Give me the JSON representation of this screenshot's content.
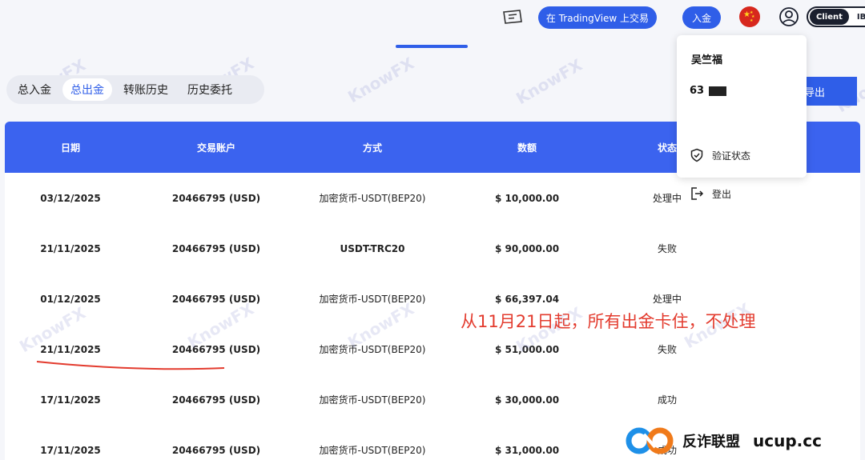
{
  "header": {
    "trade_button": "在 TradingView 上交易",
    "deposit_button": "入金",
    "role_toggle": {
      "client": "Client",
      "ib": "IB"
    },
    "ticket_icon": "ticket-icon",
    "flag_icon": "china-flag-icon",
    "user_icon": "user-icon"
  },
  "tabs": [
    {
      "label": "总入金",
      "active": false
    },
    {
      "label": "总出金",
      "active": true
    },
    {
      "label": "转账历史",
      "active": false
    },
    {
      "label": "历史委托",
      "active": false
    }
  ],
  "export_button": "导出",
  "table": {
    "columns": [
      "日期",
      "交易账户",
      "方式",
      "数额",
      "状态"
    ],
    "rows": [
      {
        "date": "03/12/2025",
        "account": "20466795 (USD)",
        "method": "加密货币-USDT(BEP20)",
        "amount": "$ 10,000.00",
        "status": "处理中"
      },
      {
        "date": "21/11/2025",
        "account": "20466795 (USD)",
        "method": "USDT-TRC20",
        "amount": "$ 90,000.00",
        "status": "失败"
      },
      {
        "date": "01/12/2025",
        "account": "20466795 (USD)",
        "method": "加密货币-USDT(BEP20)",
        "amount": "$ 66,397.04",
        "status": "处理中"
      },
      {
        "date": "21/11/2025",
        "account": "20466795 (USD)",
        "method": "加密货币-USDT(BEP20)",
        "amount": "$ 51,000.00",
        "status": "失败"
      },
      {
        "date": "17/11/2025",
        "account": "20466795 (USD)",
        "method": "加密货币-USDT(BEP20)",
        "amount": "$ 30,000.00",
        "status": "成功"
      },
      {
        "date": "17/11/2025",
        "account": "20466795 (USD)",
        "method": "加密货币-USDT(BEP20)",
        "amount": "$ 31,000.00",
        "status": "成功"
      }
    ]
  },
  "user_menu": {
    "name": "吴竺福",
    "account_id": "63",
    "items": [
      {
        "label": "验证状态",
        "icon": "shield-check-icon"
      },
      {
        "label": "登出",
        "icon": "logout-icon"
      }
    ]
  },
  "annotation": "从11月21日起，所有出金卡住，不处理",
  "watermark": "KnowFX",
  "brand": {
    "name": "反诈联盟",
    "domain": "ucup.cc"
  },
  "colors": {
    "primary": "#2f5ee8",
    "header": "#3b63ef",
    "annotation": "#e33b2e"
  }
}
